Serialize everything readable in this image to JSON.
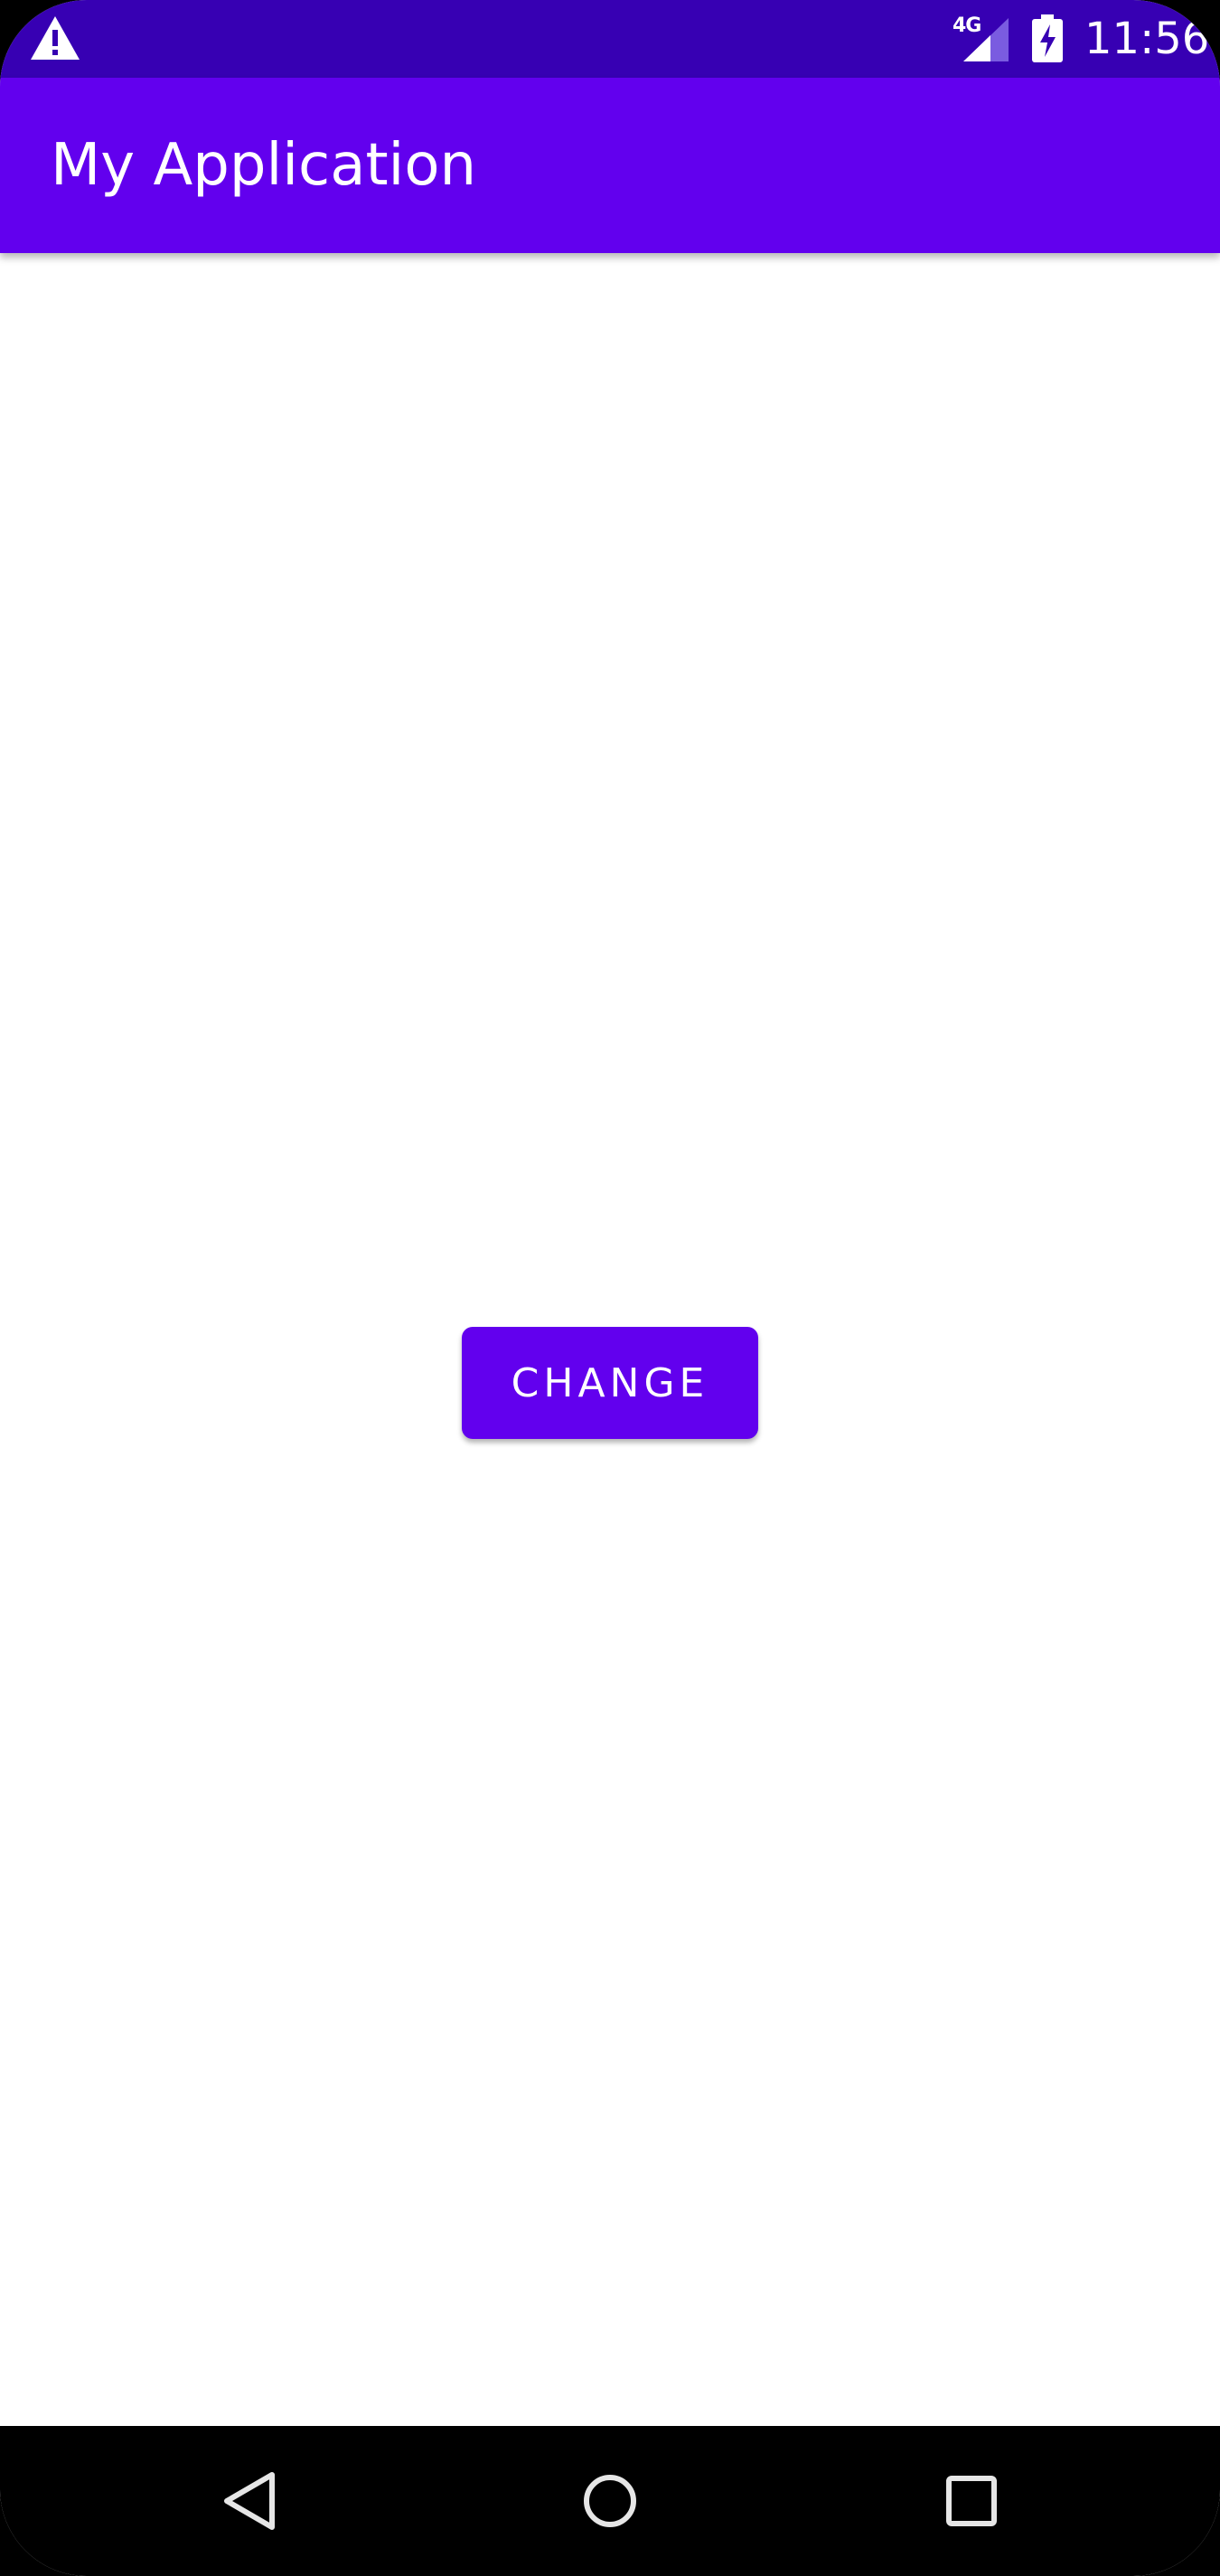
{
  "status_bar": {
    "network": "4G",
    "time": "11:56",
    "icons": [
      "warning-icon",
      "signal-icon",
      "battery-charging-icon"
    ]
  },
  "app_bar": {
    "title": "My Application"
  },
  "main": {
    "button_label": "CHANGE"
  },
  "nav_bar": {
    "icons": [
      "back-icon",
      "home-icon",
      "recents-icon"
    ]
  },
  "colors": {
    "status_bar": "#3700b3",
    "primary": "#6200ee",
    "background": "#ffffff",
    "nav_bar": "#000000",
    "on_primary": "#ffffff"
  }
}
